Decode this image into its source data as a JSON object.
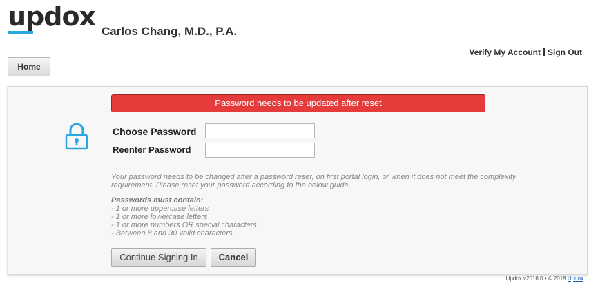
{
  "header": {
    "logo_text": "updox",
    "practice_name": "Carlos Chang, M.D., P.A.",
    "links": [
      "Verify My Account",
      "Sign Out"
    ]
  },
  "nav": {
    "home_label": "Home"
  },
  "alert": {
    "message": "Password needs to be updated after reset"
  },
  "form": {
    "choose_label": "Choose Password",
    "reenter_label": "Reenter Password",
    "choose_value": "",
    "reenter_value": ""
  },
  "info_text": "Your password needs to be changed after a password reset, on first portal login, or when it does not meet the complexity requirement. Please reset your password according to the below guide.",
  "rules": {
    "heading": "Passwords must contain:",
    "items": [
      "- 1 or more uppercase letters",
      "- 1 or more lowercase letters",
      "- 1 or more numbers OR special characters",
      "- Between 8 and 30 valid characters"
    ]
  },
  "buttons": {
    "continue_label": "Continue Signing In",
    "cancel_label": "Cancel"
  },
  "footer": {
    "version_text": "Updox v2016.0 • © 2018",
    "link_text": "Updox"
  },
  "colors": {
    "alert_red": "#e63b3b",
    "brand_blue": "#2ba6de"
  },
  "icons": {
    "lock": "lock-icon"
  }
}
